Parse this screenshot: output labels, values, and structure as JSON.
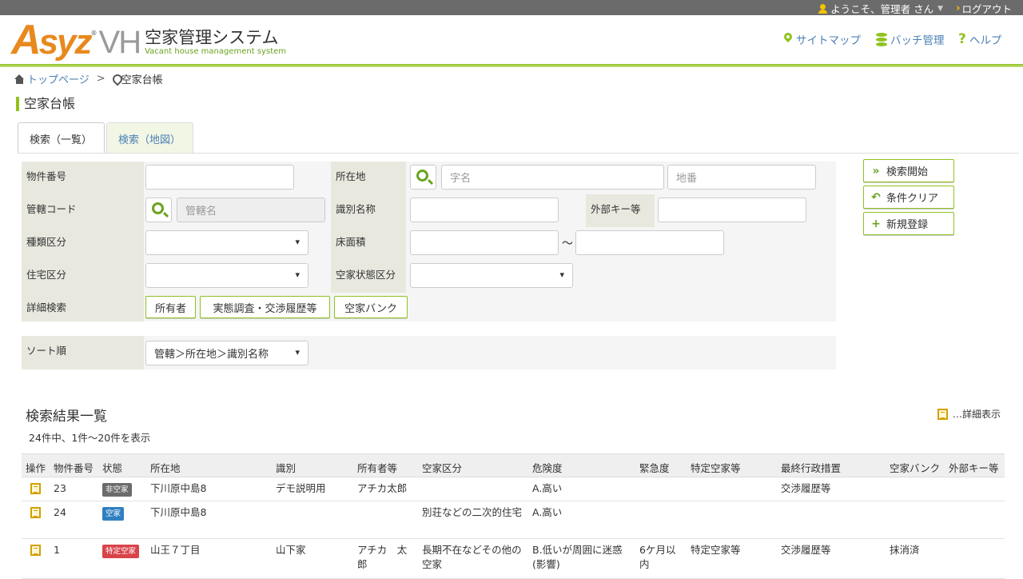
{
  "topbar": {
    "welcome": "ようこそ、管理者 さん",
    "logout": "ログアウト"
  },
  "header": {
    "logo_brand_a": "A",
    "logo_brand_syz": "syz",
    "logo_brand_reg": "®",
    "logo_brand_vh": "VH",
    "logo_title_jp": "空家管理システム",
    "logo_title_en": "Vacant house management system",
    "nav": {
      "sitemap": "サイトマップ",
      "batch": "バッチ管理",
      "help": "ヘルプ"
    }
  },
  "breadcrumb": {
    "home": "トップページ",
    "separator": ">",
    "current": "空家台帳"
  },
  "page": {
    "title": "空家台帳"
  },
  "tabs": [
    {
      "label": "検索（一覧）"
    },
    {
      "label": "検索（地図）"
    }
  ],
  "form": {
    "property_no": {
      "label": "物件番号",
      "value": ""
    },
    "location": {
      "label": "所在地",
      "placeholder_aza": "字名",
      "placeholder_chiban": "地番"
    },
    "jurisdiction": {
      "label": "管轄コード",
      "placeholder": "管轄名"
    },
    "identifier": {
      "label": "識別名称",
      "value": ""
    },
    "external_key": {
      "label": "外部キー等",
      "value": ""
    },
    "type": {
      "label": "種類区分",
      "value": ""
    },
    "floor_area": {
      "label": "床面積",
      "separator": "～"
    },
    "housing": {
      "label": "住宅区分",
      "value": ""
    },
    "vacancy_status": {
      "label": "空家状態区分",
      "value": ""
    },
    "detail_search": {
      "label": "詳細検索",
      "buttons": [
        "所有者",
        "実態調査・交渉履歴等",
        "空家バンク"
      ]
    },
    "sort": {
      "label": "ソート順",
      "value": "管轄＞所在地＞識別名称"
    }
  },
  "actions": {
    "search": "検索開始",
    "clear": "条件クリア",
    "new": "新規登録"
  },
  "results": {
    "title": "検索結果一覧",
    "count": "24件中、1件～20件を表示",
    "detail_toggle": "…詳細表示",
    "columns": [
      "操作",
      "物件番号",
      "状態",
      "所在地",
      "識別",
      "所有者等",
      "空家区分",
      "危険度",
      "緊急度",
      "特定空家等",
      "最終行政措置",
      "空家バンク",
      "外部キー等"
    ],
    "rows": [
      {
        "no": "23",
        "status": "非空家",
        "status_color": "#6b6b6b",
        "location": "下川原中島8",
        "identifier": "デモ説明用",
        "owner": "アチカ太郎",
        "vacancy": "",
        "danger": "A.高い",
        "urgency": "",
        "special": "",
        "last_action": "交渉履歴等",
        "bank": "",
        "ext": ""
      },
      {
        "no": "24",
        "status": "空家",
        "status_color": "#2f7fc1",
        "location": "下川原中島8",
        "identifier": "",
        "owner": "",
        "vacancy": "別荘などの二次的住宅",
        "danger": "A.高い",
        "urgency": "",
        "special": "",
        "last_action": "",
        "bank": "",
        "ext": ""
      },
      {
        "no": "1",
        "status": "特定空家",
        "status_color": "#d9434a",
        "location": "山王７丁目",
        "identifier": "山下家",
        "owner": "アチカ　太郎",
        "vacancy": "長期不在などその他の空家",
        "danger": "B.低いが周囲に迷惑(影響)",
        "urgency": "6ケ月以内",
        "special": "特定空家等",
        "last_action": "交渉履歴等",
        "bank": "抹消済",
        "ext": ""
      }
    ]
  }
}
